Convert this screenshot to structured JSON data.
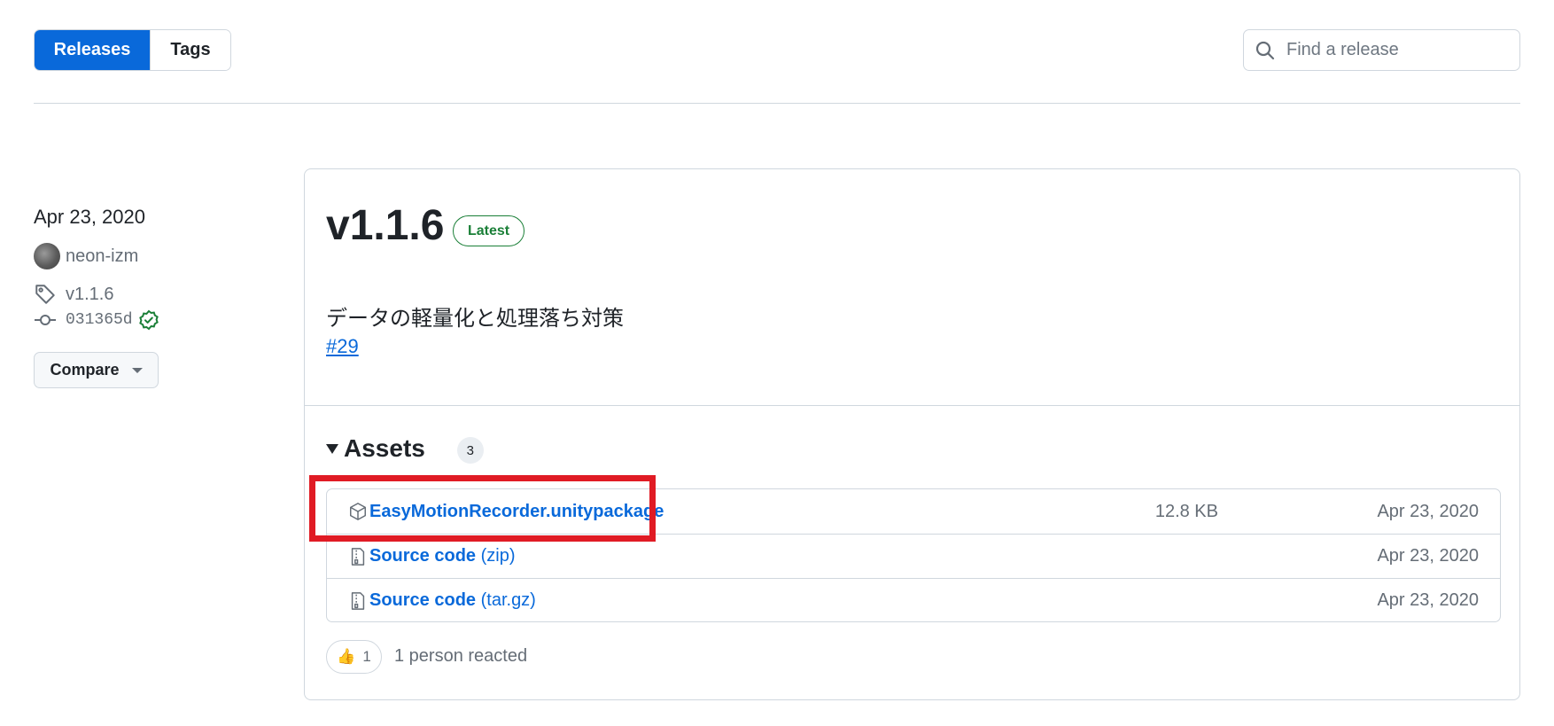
{
  "tabs": {
    "releases": "Releases",
    "tags": "Tags"
  },
  "search": {
    "placeholder": "Find a release",
    "value": ""
  },
  "release_meta": {
    "date": "Apr 23, 2020",
    "author": "neon-izm",
    "tag": "v1.1.6",
    "commit": "031365d",
    "compare_label": "Compare"
  },
  "release": {
    "version": "v1.1.6",
    "badge": "Latest",
    "description": "データの軽量化と処理落ち対策",
    "pr_link": "#29"
  },
  "assets": {
    "title": "Assets",
    "count": "3",
    "items": [
      {
        "name": "EasyMotionRecorder.unitypackage",
        "suffix": "",
        "size": "12.8 KB",
        "date": "Apr 23, 2020",
        "icon": "package-icon"
      },
      {
        "name": "Source code",
        "suffix": "(zip)",
        "size": "",
        "date": "Apr 23, 2020",
        "icon": "file-zip-icon"
      },
      {
        "name": "Source code",
        "suffix": "(tar.gz)",
        "size": "",
        "date": "Apr 23, 2020",
        "icon": "file-zip-icon"
      }
    ]
  },
  "reactions": {
    "emoji": "👍",
    "count": "1",
    "summary": "1 person reacted"
  },
  "colors": {
    "accent": "#0969da",
    "latest": "#1a7f37",
    "highlight": "#e01b24",
    "verified": "#1a7f37"
  }
}
